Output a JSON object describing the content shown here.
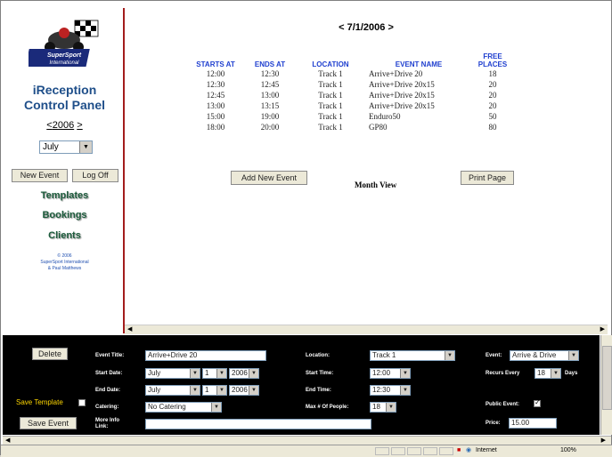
{
  "sidebar": {
    "logo_text": [
      "SuperSport",
      "International"
    ],
    "title_line1": "iReception",
    "title_line2": "Control Panel",
    "year_prev": "<",
    "year": "2006",
    "year_next": ">",
    "month": "July",
    "new_event_label": "New Event",
    "logoff_label": "Log Off",
    "links": [
      "Templates",
      "Bookings",
      "Clients"
    ],
    "copyright_line1": "© 2006",
    "copyright_line2": "SuperSport International",
    "copyright_line3": "& Paul Matthews"
  },
  "main": {
    "date_nav": "< 7/1/2006 >",
    "columns": [
      "STARTS AT",
      "ENDS AT",
      "LOCATION",
      "EVENT NAME",
      "FREE PLACES"
    ],
    "rows": [
      [
        "12:00",
        "12:30",
        "Track 1",
        "Arrive+Drive 20",
        "18"
      ],
      [
        "12:30",
        "12:45",
        "Track 1",
        "Arrive+Drive 20x15",
        "20"
      ],
      [
        "12:45",
        "13:00",
        "Track 1",
        "Arrive+Drive 20x15",
        "20"
      ],
      [
        "13:00",
        "13:15",
        "Track 1",
        "Arrive+Drive 20x15",
        "20"
      ],
      [
        "15:00",
        "19:00",
        "Track 1",
        "Enduro50",
        "50"
      ],
      [
        "18:00",
        "20:00",
        "Track 1",
        "GP80",
        "80"
      ]
    ],
    "add_event_label": "Add New Event",
    "month_view_label": "Month View",
    "print_label": "Print Page"
  },
  "form": {
    "delete_label": "Delete",
    "save_template_label": "Save Template",
    "save_event_label": "Save Event",
    "event_title_label": "Event Title:",
    "event_title_value": "Arrive+Drive 20",
    "start_date_label": "Start Date:",
    "start_month": "July",
    "start_day": "1",
    "start_year": "2006",
    "end_date_label": "End Date:",
    "end_month": "July",
    "end_day": "1",
    "end_year": "2006",
    "catering_label": "Catering:",
    "catering_value": "No Catering",
    "more_info_label_1": "More Info",
    "more_info_label_2": "Link:",
    "location_label": "Location:",
    "location_value": "Track 1",
    "start_time_label": "Start Time:",
    "start_time_value": "12:00",
    "end_time_label": "End Time:",
    "end_time_value": "12:30",
    "max_people_label": "Max # Of People:",
    "max_people_value": "18",
    "event_label": "Event:",
    "event_value": "Arrive & Drive",
    "recurs_label": "Recurs Every",
    "recurs_value": "18",
    "days_label": "Days",
    "public_label": "Public Event:",
    "price_label": "Price:",
    "price_value": "15.00"
  },
  "status": {
    "zone": "Internet",
    "zoom": "100%"
  }
}
